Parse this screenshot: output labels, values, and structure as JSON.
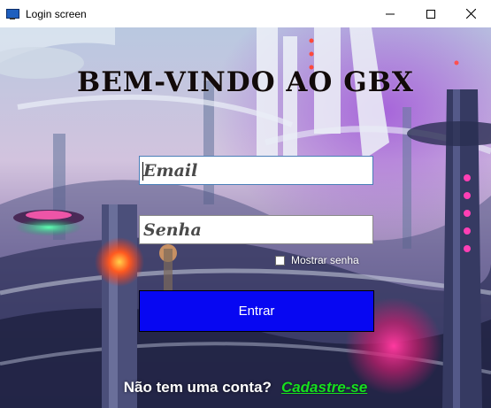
{
  "window": {
    "title": "Login screen",
    "icon": "monitor-app-icon",
    "controls": [
      "minimize-icon",
      "maximize-icon",
      "close-icon"
    ]
  },
  "login": {
    "heading": "BEM-VINDO AO GBX",
    "email_placeholder": "Email",
    "password_placeholder": "Senha",
    "show_password_label": "Mostrar senha",
    "show_password_checked": false,
    "submit_label": "Entrar"
  },
  "footer": {
    "question": "Não tem uma conta?",
    "signup_link": "Cadastre-se"
  },
  "colors": {
    "button_bg": "#0707f2",
    "link": "#16e01e",
    "heading": "#120a0a"
  }
}
